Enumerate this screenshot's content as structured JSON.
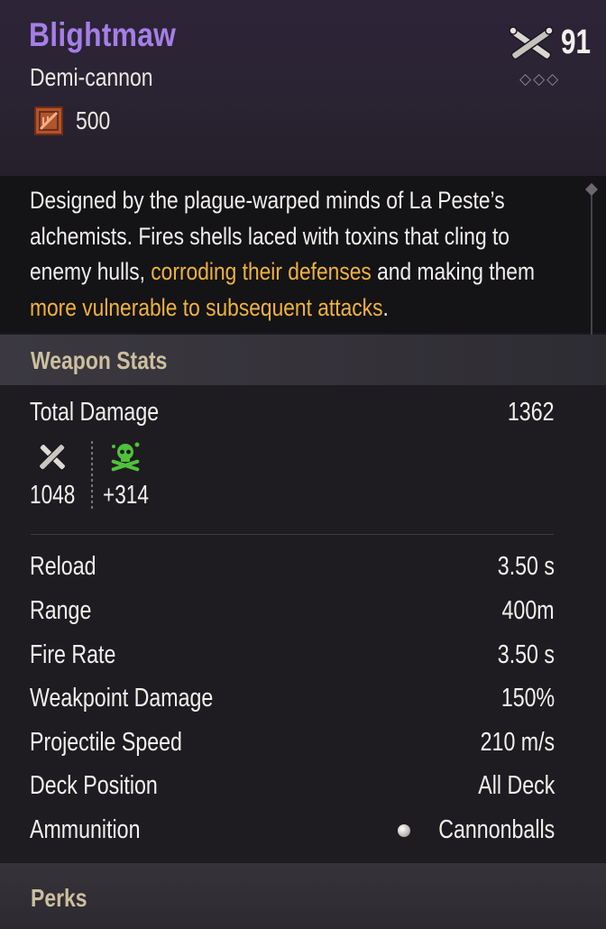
{
  "item": {
    "name": "Blightmaw",
    "type": "Demi-cannon",
    "cost": "500",
    "cost_icon": "crate-icon",
    "level": "91",
    "level_icon": "crossed-cannons-icon",
    "rank_diamonds": "◇◇◇"
  },
  "description": {
    "part1": "Designed by the plague-warped minds of La Peste’s alchemists. Fires shells laced with toxins that cling to enemy hulls, ",
    "highlight1": "corroding their defenses",
    "part2": " and making them ",
    "highlight2": "more vulnerable to subsequent attacks",
    "part3": "."
  },
  "weapon_stats": {
    "title": "Weapon Stats",
    "total_damage_label": "Total Damage",
    "total_damage_value": "1362",
    "base_damage": "1048",
    "base_damage_icon": "crossed-cannons-icon",
    "poison_damage": "+314",
    "poison_damage_icon": "poison-skull-icon",
    "rows": [
      {
        "label": "Reload",
        "value": "3.50 s"
      },
      {
        "label": "Range",
        "value": "400m"
      },
      {
        "label": "Fire Rate",
        "value": "3.50 s"
      },
      {
        "label": "Weakpoint Damage",
        "value": "150%"
      },
      {
        "label": "Projectile Speed",
        "value": "210 m/s"
      },
      {
        "label": "Deck Position",
        "value": "All Deck"
      },
      {
        "label": "Ammunition",
        "value": "Cannonballs"
      }
    ],
    "ammo_icon": "cannonball-icon"
  },
  "perks": {
    "title": "Perks"
  },
  "colors": {
    "name": "#a67ee8",
    "highlight": "#f0b23a",
    "section_title": "#cdbf9f",
    "poison": "#4fc23a"
  }
}
